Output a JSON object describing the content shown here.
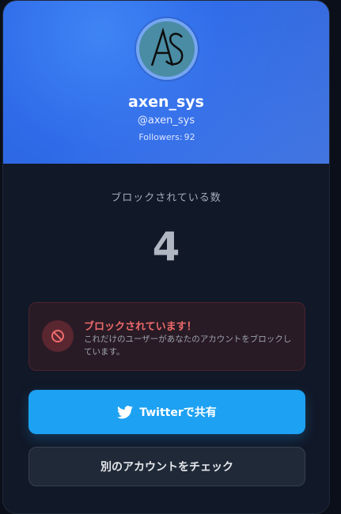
{
  "profile": {
    "name": "axen_sys",
    "handle": "@axen_sys",
    "followers_label": "Followers:",
    "followers_count": "92",
    "avatar_letters": "AS"
  },
  "blocked": {
    "label": "ブロックされている数",
    "count": "4"
  },
  "alert": {
    "title": "ブロックされています！",
    "description": "これだけのユーザーがあなたのアカウントをブロックしています。"
  },
  "buttons": {
    "share_label": "Twitterで共有",
    "check_label": "別のアカウントをチェック"
  },
  "colors": {
    "header_blue": "#2f6be8",
    "twitter_blue": "#1da1f2",
    "alert_red": "#ef6b6b",
    "background": "#111827"
  },
  "icons": {
    "share": "twitter-bird-icon",
    "alert": "block-icon"
  }
}
